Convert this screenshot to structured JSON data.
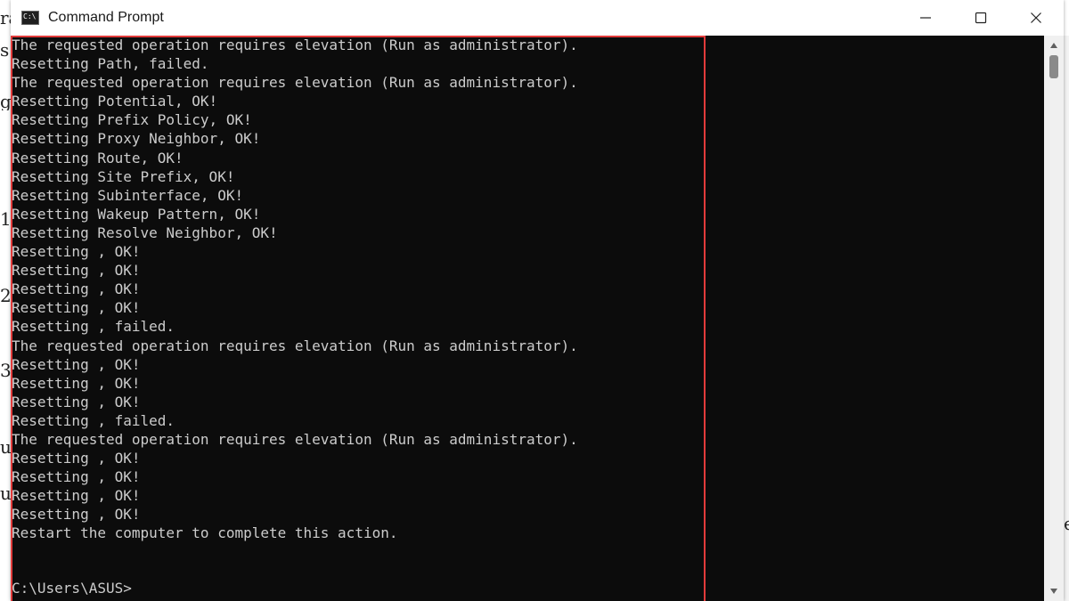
{
  "window": {
    "title": "Command Prompt",
    "icon": "cmd-icon",
    "controls": {
      "minimize_icon": "minimize-icon",
      "maximize_icon": "maximize-icon",
      "close_icon": "close-icon"
    }
  },
  "console": {
    "lines": [
      "The requested operation requires elevation (Run as administrator).",
      "Resetting Path, failed.",
      "The requested operation requires elevation (Run as administrator).",
      "Resetting Potential, OK!",
      "Resetting Prefix Policy, OK!",
      "Resetting Proxy Neighbor, OK!",
      "Resetting Route, OK!",
      "Resetting Site Prefix, OK!",
      "Resetting Subinterface, OK!",
      "Resetting Wakeup Pattern, OK!",
      "Resetting Resolve Neighbor, OK!",
      "Resetting , OK!",
      "Resetting , OK!",
      "Resetting , OK!",
      "Resetting , OK!",
      "Resetting , failed.",
      "The requested operation requires elevation (Run as administrator).",
      "Resetting , OK!",
      "Resetting , OK!",
      "Resetting , OK!",
      "Resetting , failed.",
      "The requested operation requires elevation (Run as administrator).",
      "Resetting , OK!",
      "Resetting , OK!",
      "Resetting , OK!",
      "Resetting , OK!",
      "Restart the computer to complete this action."
    ],
    "prompt": "C:\\Users\\ASUS>"
  },
  "colors": {
    "console_bg": "#0c0c0c",
    "console_text": "#cccccc",
    "highlight_border": "#e23b3b",
    "titlebar_bg": "#ffffff"
  },
  "background": {
    "left_glyphs": [
      "ra",
      "s",
      "g",
      "1",
      "2",
      "3",
      "u",
      "u"
    ],
    "right_glyph": "e"
  }
}
